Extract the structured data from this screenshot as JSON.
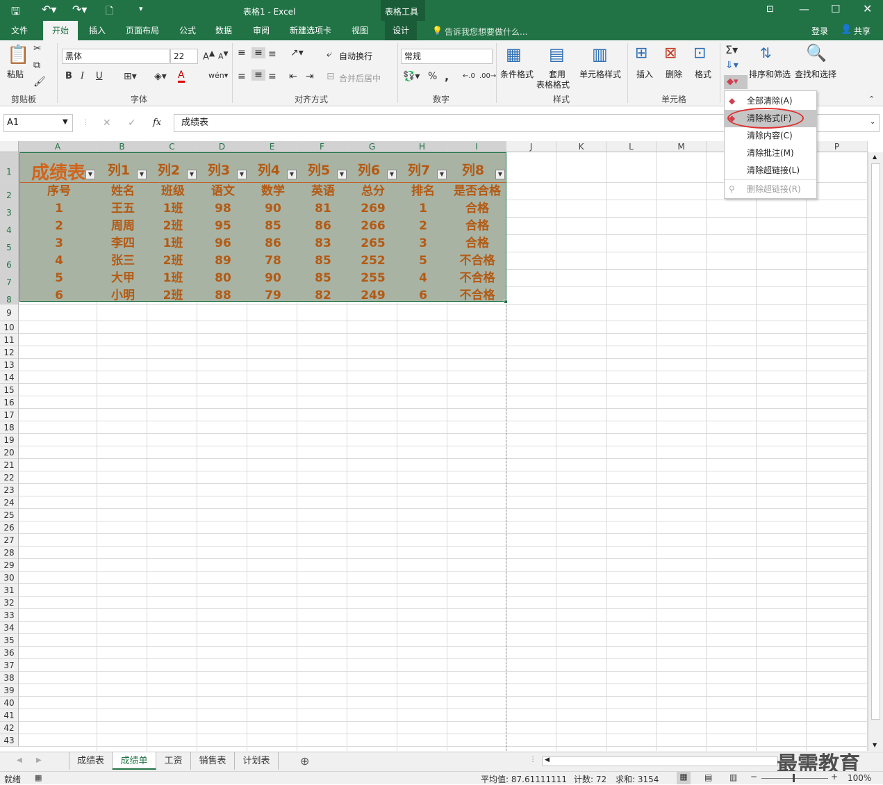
{
  "window": {
    "title": "表格1 - Excel",
    "context_tab": "表格工具",
    "login": "登录",
    "share": "共享"
  },
  "tabs": [
    "文件",
    "开始",
    "插入",
    "页面布局",
    "公式",
    "数据",
    "审阅",
    "新建选项卡",
    "视图",
    "设计"
  ],
  "tell_me": "告诉我您想要做什么...",
  "ribbon": {
    "clipboard": {
      "paste": "粘贴",
      "label": "剪贴板"
    },
    "font": {
      "name": "黑体",
      "size": "22",
      "label": "字体",
      "bold": "B",
      "italic": "I",
      "underline": "U"
    },
    "align": {
      "wrap": "自动换行",
      "merge": "合并后居中",
      "label": "对齐方式"
    },
    "number": {
      "format": "常规",
      "label": "数字",
      "percent": "%",
      "comma": ","
    },
    "styles": {
      "cond": "条件格式",
      "table": "套用",
      "table2": "表格格式",
      "cell": "单元格样式",
      "label": "样式"
    },
    "cells": {
      "insert": "插入",
      "delete": "删除",
      "format": "格式",
      "label": "单元格"
    },
    "editing": {
      "sort": "排序和筛选",
      "find": "查找和选择"
    }
  },
  "formula": {
    "namebox": "A1",
    "fx": "fx",
    "value": "成绩表"
  },
  "columns": [
    "A",
    "B",
    "C",
    "D",
    "E",
    "F",
    "G",
    "H",
    "I",
    "J",
    "K",
    "L",
    "M",
    "",
    "P"
  ],
  "rows": [
    "1",
    "2",
    "3",
    "4",
    "5",
    "6",
    "7",
    "8",
    "9",
    "10",
    "11",
    "12",
    "13",
    "14",
    "15",
    "16",
    "17",
    "18",
    "19",
    "20",
    "21",
    "22",
    "23",
    "24",
    "25",
    "26",
    "27",
    "28",
    "29",
    "30",
    "31",
    "32",
    "33",
    "34",
    "35",
    "36",
    "37",
    "38",
    "39",
    "40",
    "41",
    "42",
    "43"
  ],
  "table": {
    "header": [
      "成绩表",
      "列1",
      "列2",
      "列3",
      "列4",
      "列5",
      "列6",
      "列7",
      "列8"
    ],
    "rows": [
      [
        "序号",
        "姓名",
        "班级",
        "语文",
        "数学",
        "英语",
        "总分",
        "排名",
        "是否合格"
      ],
      [
        "1",
        "王五",
        "1班",
        "98",
        "90",
        "81",
        "269",
        "1",
        "合格"
      ],
      [
        "2",
        "周周",
        "2班",
        "95",
        "85",
        "86",
        "266",
        "2",
        "合格"
      ],
      [
        "3",
        "李四",
        "1班",
        "96",
        "86",
        "83",
        "265",
        "3",
        "合格"
      ],
      [
        "4",
        "张三",
        "2班",
        "89",
        "78",
        "85",
        "252",
        "5",
        "不合格"
      ],
      [
        "5",
        "大甲",
        "1班",
        "80",
        "90",
        "85",
        "255",
        "4",
        "不合格"
      ],
      [
        "6",
        "小明",
        "2班",
        "88",
        "79",
        "82",
        "249",
        "6",
        "不合格"
      ]
    ]
  },
  "menu": [
    {
      "label": "全部清除(A)",
      "enabled": true
    },
    {
      "label": "清除格式(F)",
      "enabled": true,
      "highlighted": true
    },
    {
      "label": "清除内容(C)",
      "enabled": true
    },
    {
      "label": "清除批注(M)",
      "enabled": true
    },
    {
      "label": "清除超链接(L)",
      "enabled": true
    },
    {
      "label": "删除超链接(R)",
      "enabled": false
    }
  ],
  "sheets": [
    "成绩表",
    "成绩单",
    "工资",
    "销售表",
    "计划表"
  ],
  "active_sheet": "成绩单",
  "status": {
    "ready": "就绪",
    "avg": "平均值: 87.61111111",
    "count": "计数: 72",
    "sum": "求和: 3154",
    "zoom": "100%"
  },
  "watermark": "最需教育",
  "colors": {
    "accent": "#217346",
    "table_bg": "#a9b3a3",
    "table_text": "#b35a14",
    "highlight_ring": "#e03030"
  }
}
